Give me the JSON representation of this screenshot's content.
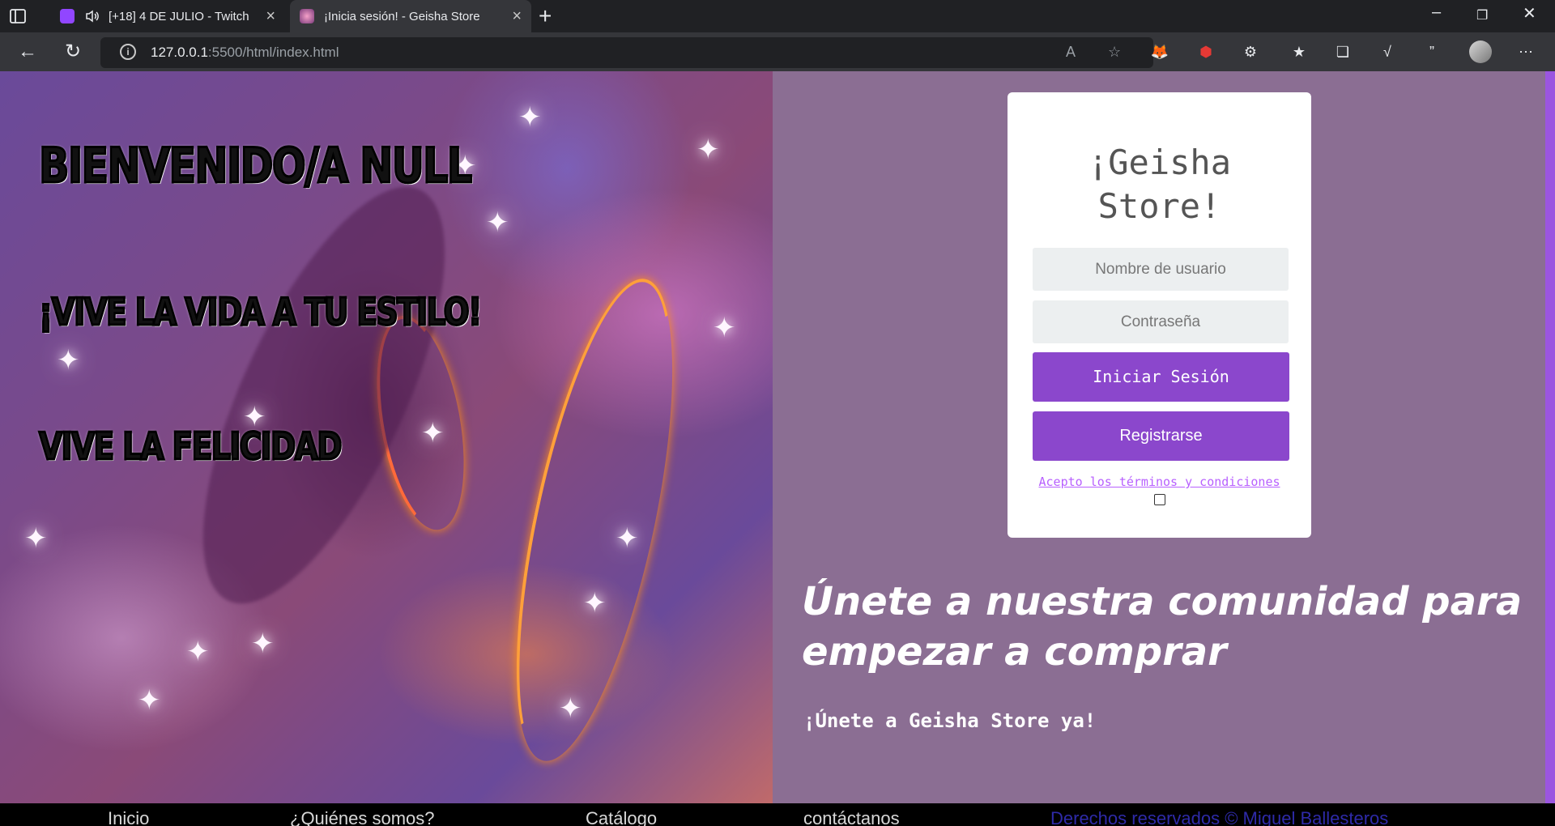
{
  "browser": {
    "tabs": [
      {
        "title": "[+18] 4 DE JULIO - Twitch",
        "active": false
      },
      {
        "title": "¡Inicia sesión! - Geisha Store",
        "active": true
      }
    ],
    "address": {
      "host": "127.0.0.1",
      "rest": ":5500/html/index.html"
    }
  },
  "hero": {
    "welcome": "Bienvenido/a null",
    "slogan": "¡Vive la vida a tu estilo!",
    "happy": "Vive la felicidad"
  },
  "login": {
    "title_line1": "¡Geisha",
    "title_line2": "Store!",
    "username_placeholder": "Nombre de usuario",
    "password_placeholder": "Contraseña",
    "login_button": "Iniciar Sesión",
    "register_button": "Registrarse",
    "terms_link": "Acepto los términos y condiciones",
    "terms_checked": false
  },
  "join": {
    "headline": "Únete a nuestra comunidad para empezar a comprar",
    "cta": "¡Únete a Geisha Store ya!"
  },
  "footer": {
    "items": [
      "Inicio",
      "¿Quiénes somos?",
      "Catálogo",
      "contáctanos"
    ],
    "copyright": "Derechos reservados © Miguel Ballesteros"
  },
  "colors": {
    "accent": "#8b47cc",
    "page_bg": "#8b6e93",
    "terms_link": "#b860ff"
  }
}
